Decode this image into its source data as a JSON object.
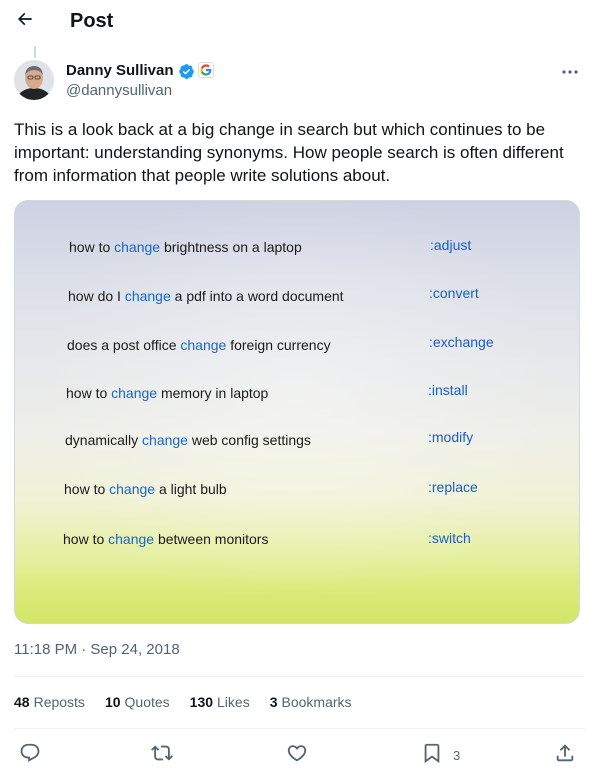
{
  "header": {
    "title": "Post"
  },
  "author": {
    "name": "Danny Sullivan",
    "handle": "@dannysullivan"
  },
  "post": {
    "text": "This is a look back at a big change in search but which continues to be important: understanding synonyms. How people search is often different from information that people write solutions about.",
    "timestamp": "11:18 PM · Sep 24, 2018",
    "image": {
      "rows": [
        {
          "before": "how to ",
          "keyword": "change",
          "after": " brightness on a laptop",
          "synonym": ":adjust"
        },
        {
          "before": "how do I ",
          "keyword": "change",
          "after": " a pdf into a word document",
          "synonym": ":convert"
        },
        {
          "before": "does a post office ",
          "keyword": "change",
          "after": " foreign currency",
          "synonym": ":exchange"
        },
        {
          "before": "how to ",
          "keyword": "change",
          "after": " memory in laptop",
          "synonym": ":install"
        },
        {
          "before": "dynamically ",
          "keyword": "change",
          "after": " web config settings",
          "synonym": ":modify"
        },
        {
          "before": "how to ",
          "keyword": "change",
          "after": " a light bulb",
          "synonym": ":replace"
        },
        {
          "before": "how to ",
          "keyword": "change",
          "after": " between monitors",
          "synonym": ":switch"
        }
      ]
    }
  },
  "stats": {
    "reposts": {
      "count": "48",
      "label": "Reposts"
    },
    "quotes": {
      "count": "10",
      "label": "Quotes"
    },
    "likes": {
      "count": "130",
      "label": "Likes"
    },
    "bookmarks": {
      "count": "3",
      "label": "Bookmarks"
    }
  },
  "actions": {
    "reply": {
      "icon": "reply-icon"
    },
    "repost": {
      "icon": "repost-icon"
    },
    "like": {
      "icon": "heart-icon"
    },
    "bookmark": {
      "icon": "bookmark-icon",
      "count": "3"
    },
    "share": {
      "icon": "share-icon"
    }
  },
  "colors": {
    "accent": "#1d9bf0",
    "text": "#0f1419",
    "muted": "#536471",
    "keyword_blue": "#1a66c9"
  }
}
